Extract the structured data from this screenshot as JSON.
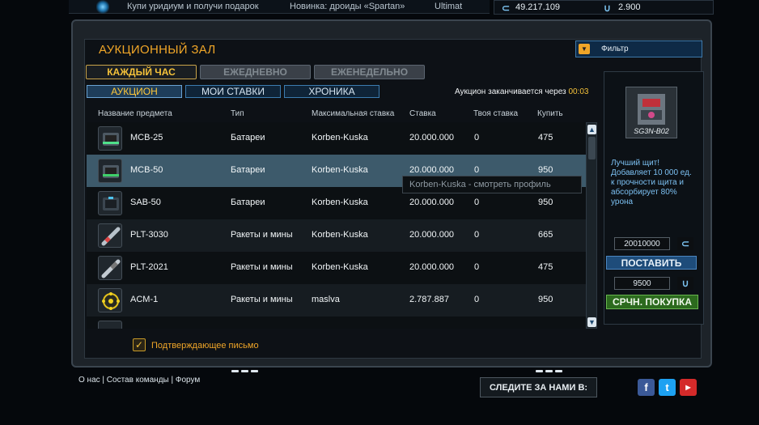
{
  "ticker": {
    "items": [
      "Купи уридиум и получи подарок",
      "Новинка: дроиды «Spartan»",
      "Ultimat"
    ]
  },
  "currency": {
    "credits": "49.217.109",
    "uridium": "2.900"
  },
  "auction": {
    "title": "АУКЦИОННЫЙ ЗАЛ",
    "tabs": [
      "КАЖДЫЙ ЧАС",
      "ЕЖЕДНЕВНО",
      "ЕЖЕНЕДЕЛЬНО"
    ],
    "subtabs": [
      "АУКЦИОН",
      "МОИ СТАВКИ",
      "ХРОНИКА"
    ],
    "ends_label": "Аукцион заканчивается через",
    "ends_time": "00:03",
    "columns": [
      "Название предмета",
      "Тип",
      "Максимальная ставка",
      "Ставка",
      "Твоя ставка",
      "Купить"
    ],
    "rows": [
      {
        "name": "MCB-25",
        "type": "Батареи",
        "max_bid": "Korben-Kuska",
        "bid": "20.000.000",
        "your_bid": "0",
        "buy": "475",
        "icon": "battery-box-icon"
      },
      {
        "name": "MCB-50",
        "type": "Батареи",
        "max_bid": "Korben-Kuska",
        "bid": "20.000.000",
        "your_bid": "0",
        "buy": "950",
        "icon": "battery-box-icon"
      },
      {
        "name": "SAB-50",
        "type": "Батареи",
        "max_bid": "Korben-Kuska",
        "bid": "20.000.000",
        "your_bid": "0",
        "buy": "950",
        "icon": "battery-box-icon"
      },
      {
        "name": "PLT-3030",
        "type": "Ракеты и мины",
        "max_bid": "Korben-Kuska",
        "bid": "20.000.000",
        "your_bid": "0",
        "buy": "665",
        "icon": "rocket-icon"
      },
      {
        "name": "PLT-2021",
        "type": "Ракеты и мины",
        "max_bid": "Korben-Kuska",
        "bid": "20.000.000",
        "your_bid": "0",
        "buy": "475",
        "icon": "rocket-icon"
      },
      {
        "name": "ACM-1",
        "type": "Ракеты и мины",
        "max_bid": "maslva",
        "bid": "2.787.887",
        "your_bid": "0",
        "buy": "950",
        "icon": "mine-icon"
      }
    ],
    "tooltip": "Korben-Kuska - смотреть профиль",
    "confirm_label": "Подтверждающее письмо"
  },
  "sidebar": {
    "filter_label": "Фильтр",
    "item_name": "SG3N-B02",
    "item_desc": "Лучший щит! Добавляет 10 000 ед. к прочности щита и абсорбирует 80% урона",
    "bid_value": "20010000",
    "bid_button": "ПОСТАВИТЬ",
    "price_value": "9500",
    "buy_button": "СРЧН. ПОКУПКА"
  },
  "footer": {
    "links": [
      "О нас",
      "Состав команды",
      "Форум"
    ],
    "follow_label": "СЛЕДИТЕ ЗА НАМИ В:",
    "social": [
      "facebook-icon",
      "twitter-icon",
      "youtube-icon"
    ]
  }
}
